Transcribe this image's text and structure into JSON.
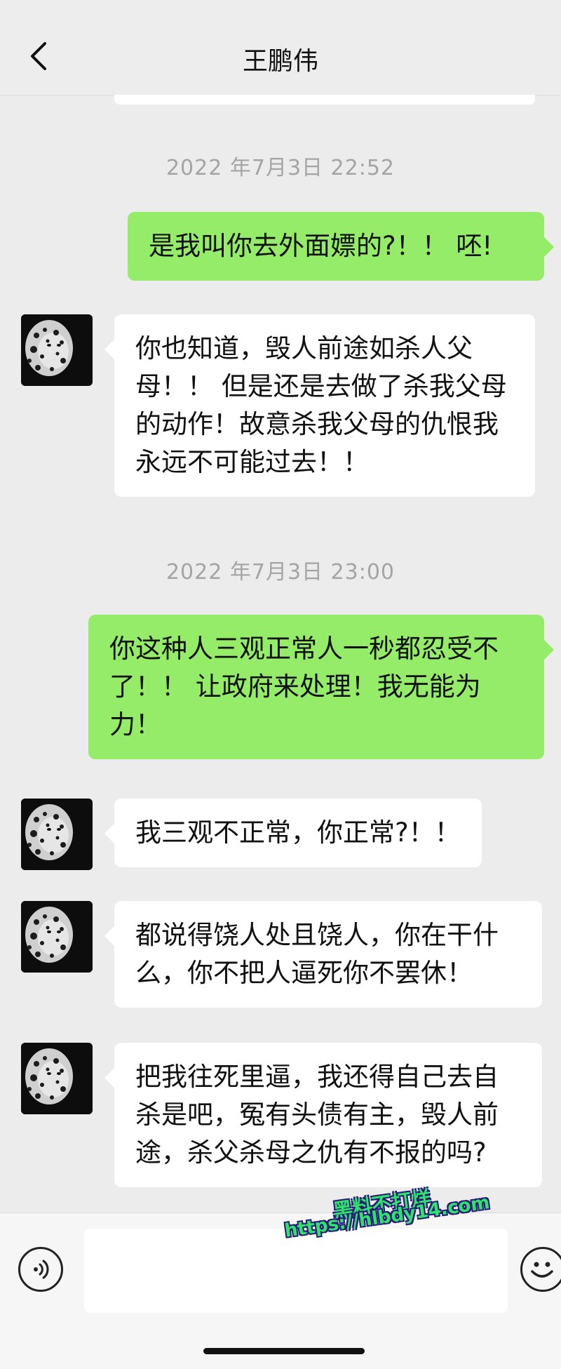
{
  "header": {
    "title": "王鹏伟",
    "back_icon": "chevron-left-icon"
  },
  "messages": [
    {
      "type": "timestamp",
      "text": "2022 年7月3日 22:52"
    },
    {
      "type": "sent",
      "text": "是我叫你去外面嫖的?！！ 呸!"
    },
    {
      "type": "received",
      "text": "你也知道，毁人前途如杀人父母！！ 但是还是去做了杀我父母的动作！故意杀我父母的仇恨我永远不可能过去！！"
    },
    {
      "type": "timestamp",
      "text": "2022 年7月3日 23:00"
    },
    {
      "type": "sent",
      "text": "你这种人三观正常人一秒都忍受不了！！ 让政府来处理！我无能为力！"
    },
    {
      "type": "received",
      "text": "我三观不正常，你正常?！！"
    },
    {
      "type": "received",
      "text": "都说得饶人处且饶人，你在干什么，你不把人逼死你不罢休！"
    },
    {
      "type": "received",
      "text": "把我往死里逼，我还得自己去自杀是吧，冤有头债有主，毁人前途，杀父杀母之仇有不报的吗?"
    }
  ],
  "watermark": {
    "line1": "黑料不打烊",
    "line2": "https://hlbdy14.com"
  },
  "input": {
    "value": "",
    "voice_icon": "voice-icon",
    "emoji_icon": "emoji-icon"
  },
  "colors": {
    "sent_bubble": "#95ec69",
    "received_bubble": "#ffffff",
    "background": "#ececec"
  }
}
